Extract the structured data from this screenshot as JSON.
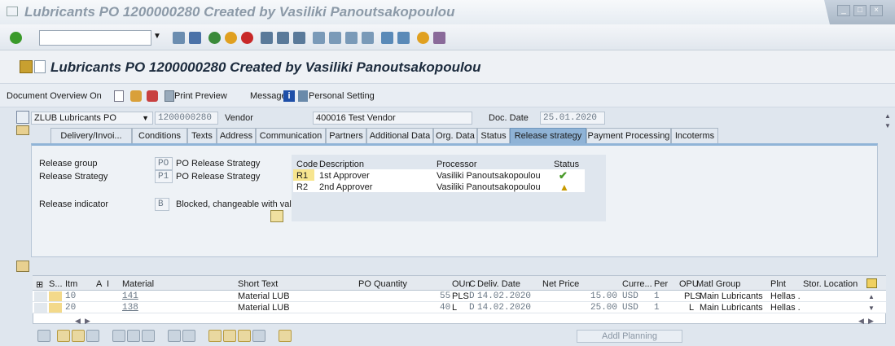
{
  "window": {
    "title": "Lubricants PO 1200000280 Created by Vasiliki Panoutsakopoulou"
  },
  "screen": {
    "title": "Lubricants PO 1200000280 Created by Vasiliki Panoutsakopoulou"
  },
  "appbar": {
    "document_overview": "Document Overview On",
    "print_preview": "Print Preview",
    "messages": "Messages",
    "personal_setting": "Personal Setting"
  },
  "header": {
    "doc_type": "ZLUB Lubricants PO",
    "po_number": "1200000280",
    "vendor_label": "Vendor",
    "vendor_value": "400016 Test Vendor",
    "doc_date_label": "Doc. Date",
    "doc_date_value": "25.01.2020"
  },
  "tabs": [
    "Delivery/Invoi...",
    "Conditions",
    "Texts",
    "Address",
    "Communication",
    "Partners",
    "Additional Data",
    "Org. Data",
    "Status",
    "Release strategy",
    "Payment Processing",
    "Incoterms"
  ],
  "release": {
    "group_label": "Release group",
    "group_code": "PO",
    "group_text": "PO Release Strategy",
    "strategy_label": "Release Strategy",
    "strategy_code": "P1",
    "strategy_text": "PO Release Strategy",
    "indicator_label": "Release indicator",
    "indicator_code": "B",
    "indicator_text": "Blocked, changeable with val."
  },
  "release_table": {
    "headers": [
      "Code",
      "Description",
      "Processor",
      "Status"
    ],
    "rows": [
      {
        "code": "R1",
        "description": "1st Approver",
        "processor": "Vasiliki Panoutsakopoulou",
        "status_icon": "checkmark-icon"
      },
      {
        "code": "R2",
        "description": "2nd Approver",
        "processor": "Vasiliki Panoutsakopoulou",
        "status_icon": "warning-triangle-icon"
      }
    ]
  },
  "items": {
    "headers": [
      "S...",
      "Itm",
      "A",
      "I",
      "Material",
      "Short Text",
      "PO Quantity",
      "OUn",
      "C",
      "Deliv. Date",
      "Net Price",
      "Curre...",
      "Per",
      "OPU",
      "Matl Group",
      "Plnt",
      "Stor. Location"
    ],
    "rows": [
      {
        "itm": "10",
        "material": "141",
        "short_text": "Material LUB",
        "quantity": "55",
        "oun": "PLS",
        "c": "D",
        "date": "14.02.2020",
        "price": "15.00",
        "curr": "USD",
        "per": "1",
        "opu": "PLS",
        "matl_group": "Main Lubricants",
        "plnt": "Hellas ."
      },
      {
        "itm": "20",
        "material": "138",
        "short_text": "Material LUB",
        "quantity": "40",
        "oun": "L",
        "c": "D",
        "date": "14.02.2020",
        "price": "25.00",
        "curr": "USD",
        "per": "1",
        "opu": "L",
        "matl_group": "Main Lubricants",
        "plnt": "Hellas ."
      }
    ]
  },
  "bottom": {
    "addl_planning": "Addl Planning"
  },
  "colors": {
    "accent": "#8fb3d6",
    "title_text": "#1c2b3d",
    "check_green": "#4a9a2a",
    "warning_yellow": "#f2c500"
  }
}
